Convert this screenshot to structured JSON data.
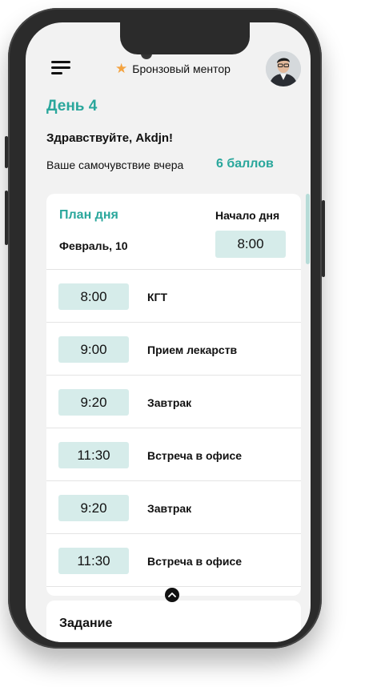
{
  "header": {
    "mentor_label": "Бронзовый ментор",
    "mentor_icon": "star-icon",
    "menu_icon": "hamburger-menu-icon",
    "avatar_icon": "user-avatar"
  },
  "day_title": "День 4",
  "greeting": "Здравствуйте, Akdjn!",
  "wellbeing": {
    "label": "Ваше самочувствие вчера",
    "score": "6 баллов"
  },
  "plan": {
    "title": "План дня",
    "date": "Февраль, 10",
    "start_label": "Начало дня",
    "start_time": "8:00",
    "items": [
      {
        "time": "8:00",
        "label": "КГТ"
      },
      {
        "time": "9:00",
        "label": "Прием лекарств"
      },
      {
        "time": "9:20",
        "label": "Завтрак"
      },
      {
        "time": "11:30",
        "label": "Встреча в офисе"
      },
      {
        "time": "9:20",
        "label": "Завтрак"
      },
      {
        "time": "11:30",
        "label": "Встреча в офисе"
      }
    ]
  },
  "task": {
    "title": "Задание"
  },
  "colors": {
    "accent": "#2aa79c",
    "chip": "#d6ecea",
    "star": "#f4a340"
  }
}
